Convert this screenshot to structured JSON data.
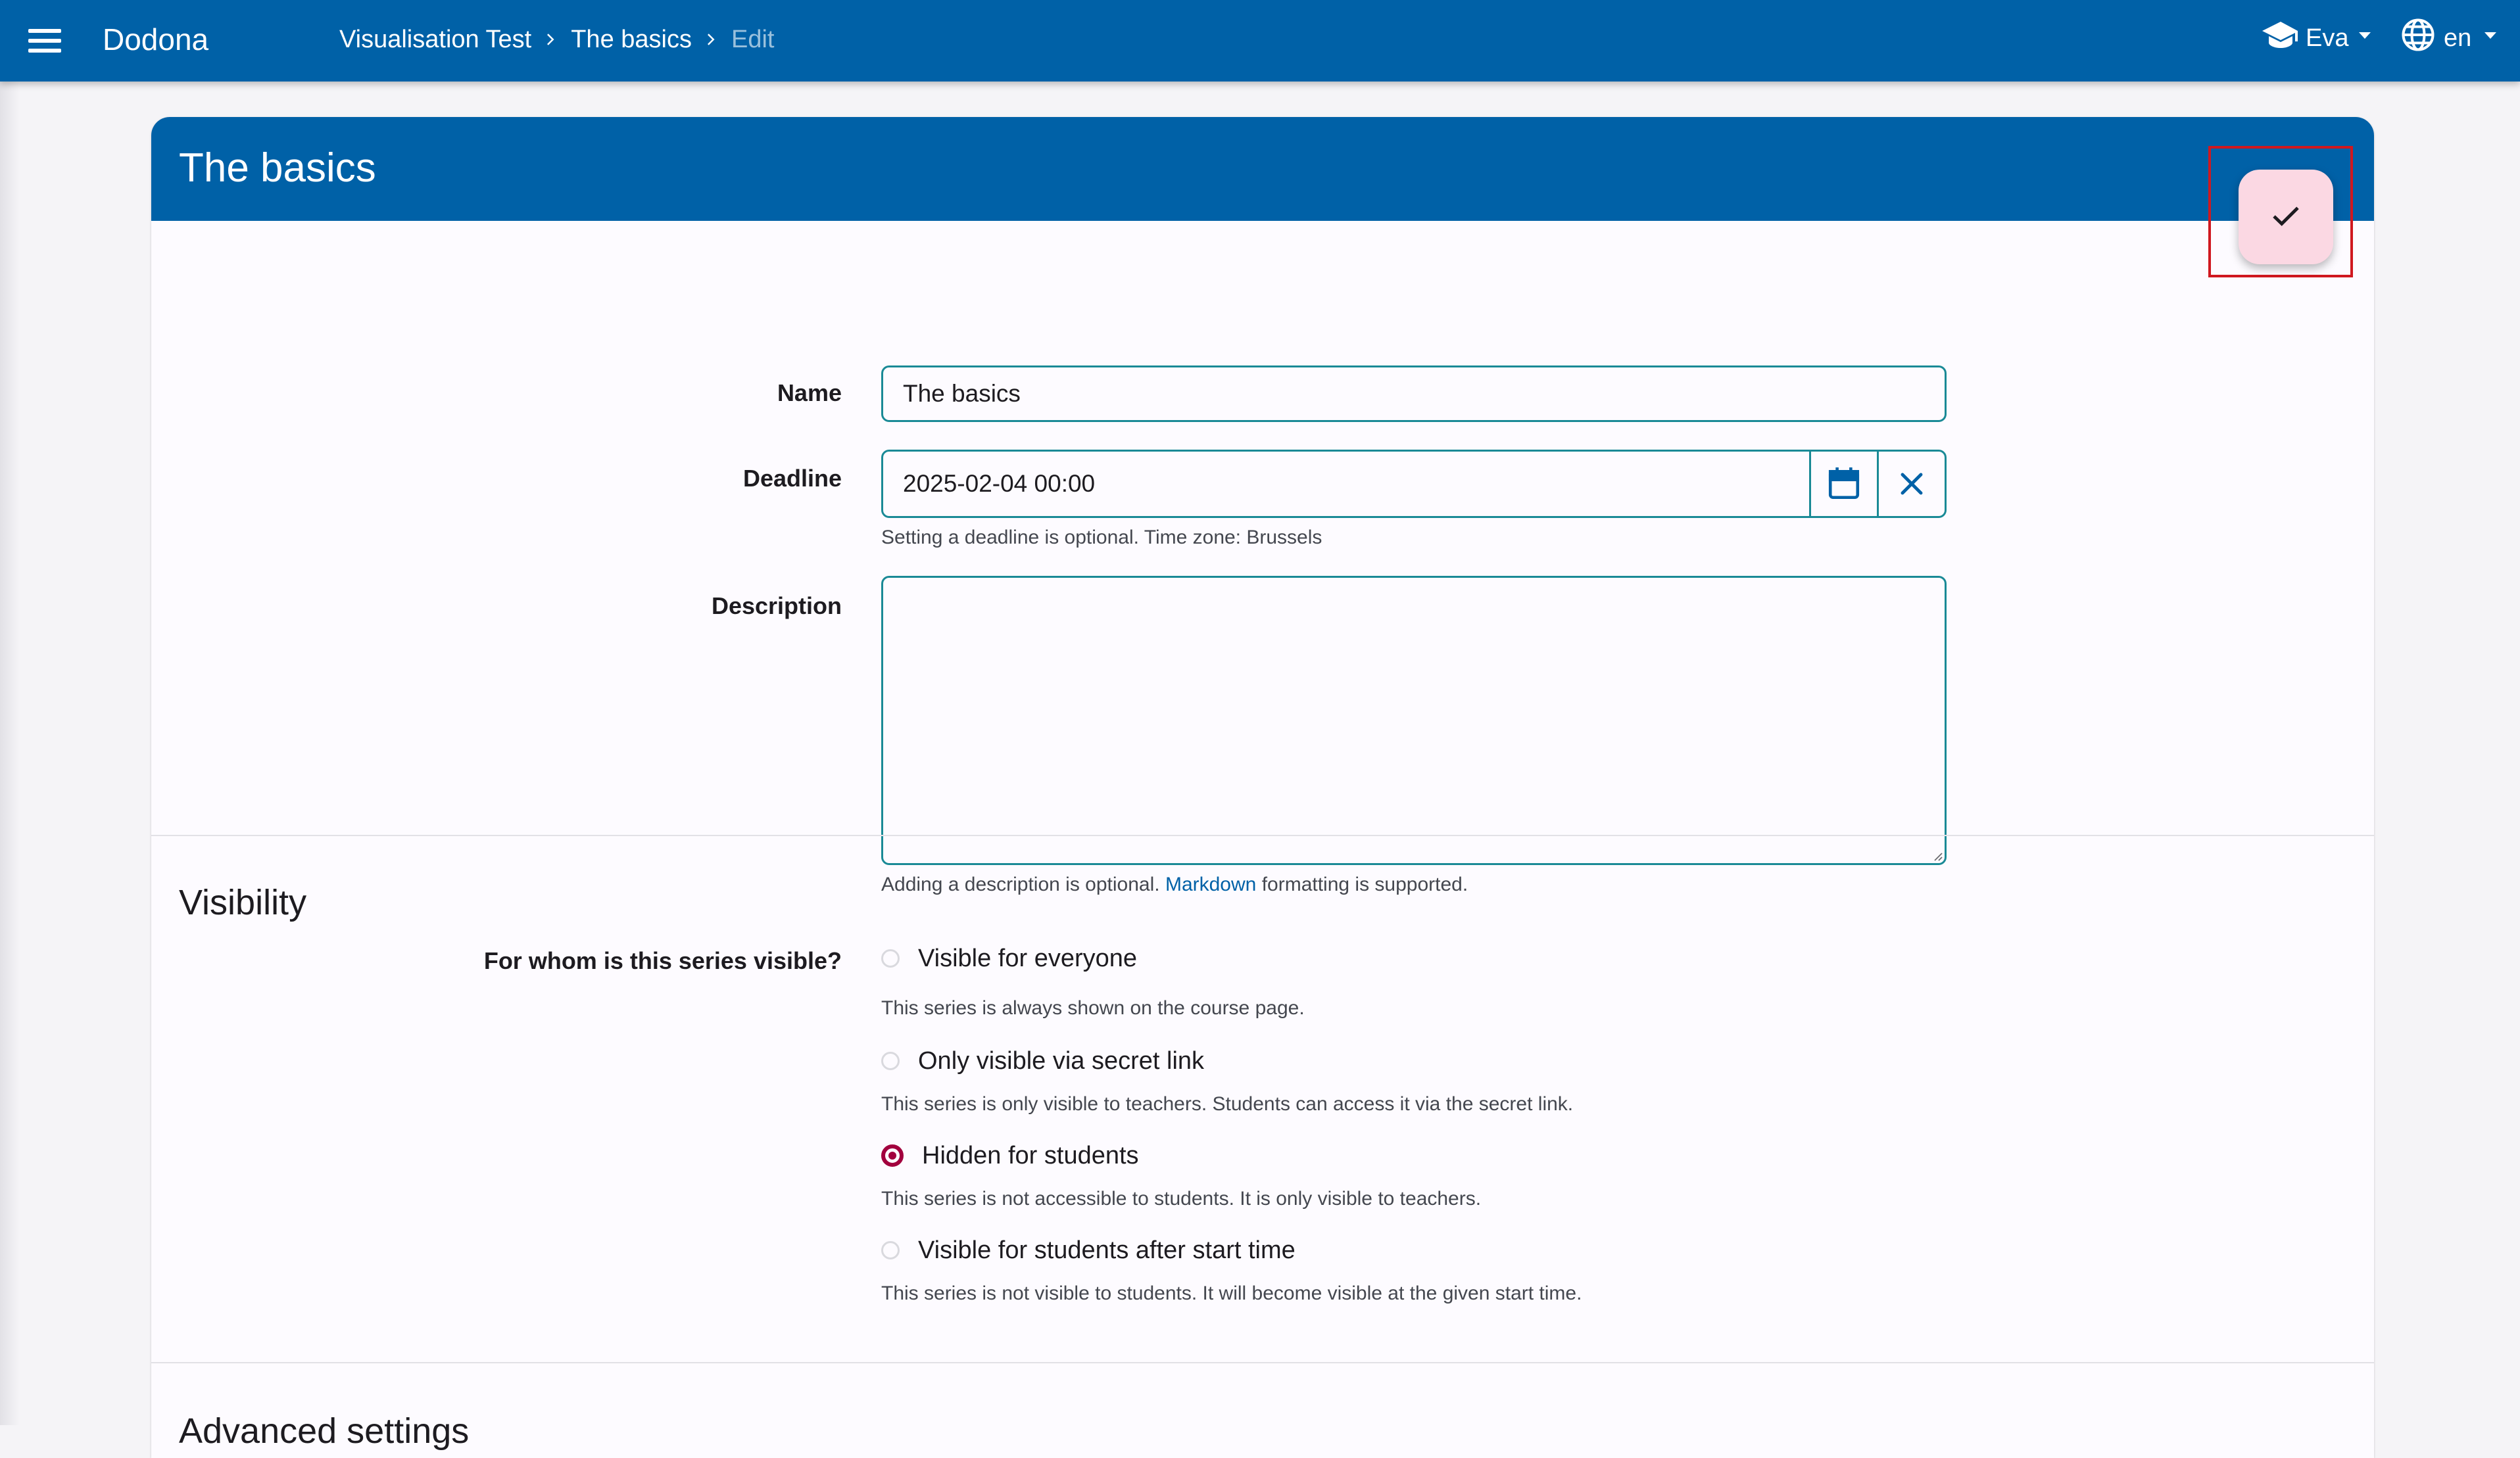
{
  "app": {
    "brand": "Dodona"
  },
  "breadcrumb": [
    {
      "label": "Visualisation Test"
    },
    {
      "label": "The basics"
    },
    {
      "label": "Edit"
    }
  ],
  "user_menu": {
    "name": "Eva",
    "icon": "graduation-cap-icon"
  },
  "lang_menu": {
    "code": "en",
    "icon": "globe-icon"
  },
  "card": {
    "title": "The basics"
  },
  "form": {
    "name": {
      "label": "Name",
      "value": "The basics"
    },
    "deadline": {
      "label": "Deadline",
      "value": "2025-02-04 00:00",
      "help": "Setting a deadline is optional. Time zone: Brussels"
    },
    "description": {
      "label": "Description",
      "value": "",
      "help_prefix": "Adding a description is optional.",
      "help_link": "Markdown",
      "help_suffix": "formatting is supported."
    }
  },
  "visibility": {
    "title": "Visibility",
    "question": "For whom is this series visible?",
    "options": [
      {
        "label": "Visible for everyone",
        "help": "This series is always shown on the course page.",
        "checked": false
      },
      {
        "label": "Only visible via secret link",
        "help": "This series is only visible to teachers. Students can access it via the secret link.",
        "checked": false
      },
      {
        "label": "Hidden for students",
        "help": "This series is not accessible to students. It is only visible to teachers.",
        "checked": true
      },
      {
        "label": "Visible for students after start time",
        "help": "This series is not visible to students. It will become visible at the given start time.",
        "checked": false
      }
    ]
  },
  "advanced": {
    "title": "Advanced settings"
  },
  "colors": {
    "primary": "#0061a7",
    "fab_background": "#fbd8e3",
    "radio_checked": "#a2003e",
    "input_border": "#1a8a96",
    "highlight": "#d0181f"
  }
}
